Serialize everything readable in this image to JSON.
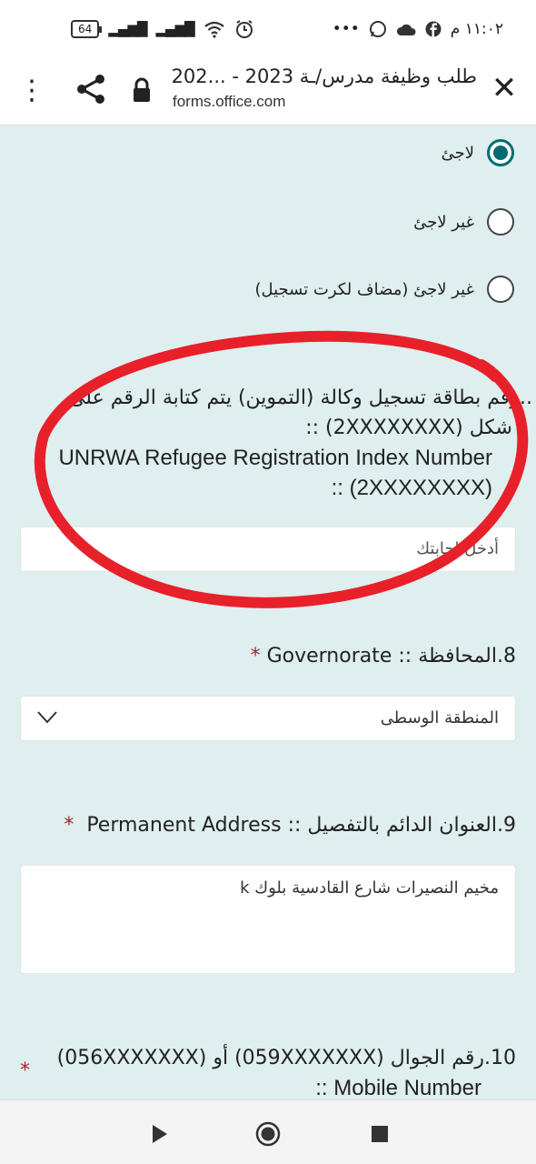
{
  "status_bar": {
    "battery": "64",
    "time": "١١:٠٢ م",
    "more": "•••"
  },
  "browser": {
    "title": "طلب وظيفة مدرس/ـة 2023 - ...202",
    "url": "forms.office.com",
    "menu_icon": "more-vert-icon",
    "share_icon": "share-icon",
    "lock_icon": "lock-icon",
    "close_icon": "close-icon"
  },
  "status_question": {
    "options": [
      {
        "label": "لاجئ",
        "selected": true
      },
      {
        "label": "غير لاجئ",
        "selected": false
      },
      {
        "label": "غير لاجئ (مضاف لكرت تسجيل)",
        "selected": false
      }
    ]
  },
  "q7": {
    "line1": "..رقم بطاقة تسجيل وكالة (التموين) يتم كتابة الرقم على",
    "line2": "شكل (2XXXXXXXX) ::",
    "line3": "UNRWA Refugee Registration Index Number",
    "line4": ":: (2XXXXXXXX)",
    "placeholder": "أدخل إجابتك"
  },
  "q8": {
    "number": "8.",
    "label": "المحافظة :: Governorate",
    "required": "*",
    "selected": "المنطقة الوسطى"
  },
  "q9": {
    "number": "9.",
    "label": "العنوان الدائم بالتفصيل :: Permanent Address",
    "required": "*",
    "value": "مخيم النصيرات شارع القادسية بلوك k"
  },
  "q10": {
    "number": "10.",
    "line1": "رقم الجوال (059XXXXXXX) أو (056XXXXXXX)",
    "line2": ":: Mobile Number",
    "required": "*"
  },
  "colors": {
    "background": "#dfeeee",
    "accent": "#036c70",
    "required": "#a4262c",
    "annotation": "#e8202a"
  }
}
